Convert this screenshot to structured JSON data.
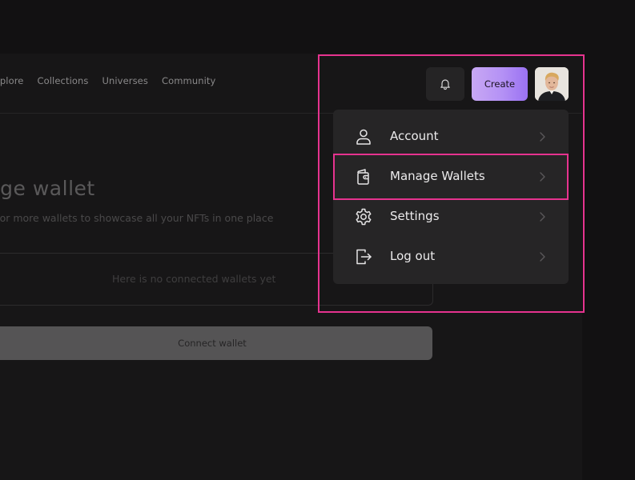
{
  "nav": {
    "links": [
      "xplore",
      "Collections",
      "Universes",
      "Community"
    ],
    "notifications_icon": "bell-icon",
    "create_label": "Create",
    "avatar_icon": "user-avatar"
  },
  "page": {
    "heading": "nage wallet",
    "subtitle": "ne or more wallets to showcase all your NFTs in one place",
    "empty_state": "Here is no connected wallets yet",
    "connect_label": "Connect wallet"
  },
  "menu": {
    "items": [
      {
        "label": "Account",
        "icon": "user-icon"
      },
      {
        "label": "Manage Wallets",
        "icon": "wallet-icon"
      },
      {
        "label": "Settings",
        "icon": "gear-icon"
      },
      {
        "label": "Log out",
        "icon": "logout-icon"
      }
    ]
  },
  "colors": {
    "background": "#121112",
    "panel": "#171617",
    "dropdown": "#262526",
    "highlight": "#e6338f",
    "accent_gradient_start": "#c8a8f4",
    "accent_gradient_end": "#9a72f2"
  }
}
